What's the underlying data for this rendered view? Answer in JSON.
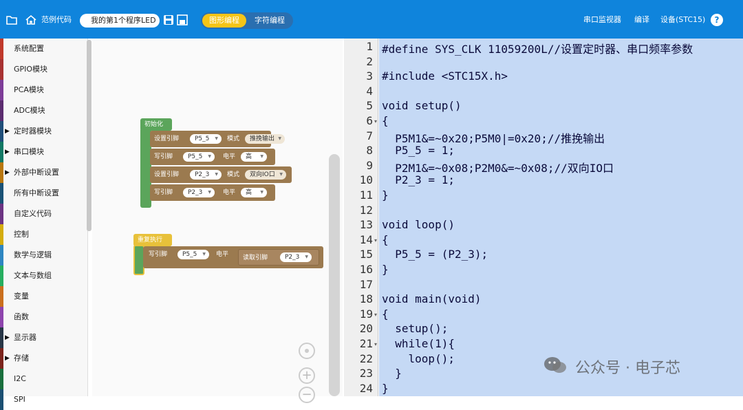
{
  "colors": {
    "topbar": "#0f84dc",
    "tab_active": "#f5c518",
    "selection": "#c5d9f5",
    "init_block": "#5ba55b",
    "loop_block": "#e8c13a",
    "io_block": "#9b7a4f"
  },
  "toolbar": {
    "open_icon": "folder-open-icon",
    "examples_icon": "home-icon",
    "examples_label": "范例代码",
    "project_name": "我的第1个程序LED",
    "tabs": [
      "图形编程",
      "字符编程"
    ],
    "serial_monitor": "串口监视器",
    "compile": "编译",
    "device": "设备(STC15)",
    "help": "?"
  },
  "sidebar": {
    "items": [
      {
        "label": "系统配置",
        "color": "#c0392b",
        "arrow": false
      },
      {
        "label": "GPIO模块",
        "color": "#a83232",
        "arrow": false
      },
      {
        "label": "PCA模块",
        "color": "#7d3c98",
        "arrow": false
      },
      {
        "label": "ADC模块",
        "color": "#5b2c6f",
        "arrow": false
      },
      {
        "label": "定时器模块",
        "color": "#1f4e79",
        "arrow": true
      },
      {
        "label": "串口模块",
        "color": "#117864",
        "arrow": true
      },
      {
        "label": "外部中断设置",
        "color": "#b9770e",
        "arrow": true
      },
      {
        "label": "所有中断设置",
        "color": "#1a5276",
        "arrow": false
      },
      {
        "label": "自定义代码",
        "color": "#6c3483",
        "arrow": false
      },
      {
        "label": "控制",
        "color": "#d4ac0d",
        "arrow": false
      },
      {
        "label": "数学与逻辑",
        "color": "#2e86c1",
        "arrow": false
      },
      {
        "label": "文本与数组",
        "color": "#27ae60",
        "arrow": false
      },
      {
        "label": "变量",
        "color": "#ca6f1e",
        "arrow": false
      },
      {
        "label": "函数",
        "color": "#8e44ad",
        "arrow": false
      },
      {
        "label": "显示器",
        "color": "#283747",
        "arrow": true
      },
      {
        "label": "存储",
        "color": "#7b241c",
        "arrow": true
      },
      {
        "label": "I2C",
        "color": "#196f3d",
        "arrow": false
      },
      {
        "label": "SPI",
        "color": "#1b4f72",
        "arrow": false
      }
    ]
  },
  "blocks": {
    "init_label": "初始化",
    "set_pin": "设置引脚",
    "mode": "模式",
    "write_pin": "写引脚",
    "level": "电平",
    "pin_p55": "P5_5",
    "pin_p23": "P2_3",
    "mode_pushpull": "推挽输出",
    "mode_bidir": "双向IO口",
    "high": "高",
    "loop_label": "重复执行",
    "read_pin": "读取引脚"
  },
  "controls": {
    "center_icon": "target-icon",
    "zoom_in": "+",
    "zoom_out": "−"
  },
  "code": {
    "lines": [
      "#define SYS_CLK 11059200L//设置定时器、串口频率参数",
      "",
      "#include <STC15X.h>",
      "",
      "void setup()",
      "{",
      "  P5M1&=~0x20;P5M0|=0x20;//推挽输出",
      "  P5_5 = 1;",
      "  P2M1&=~0x08;P2M0&=~0x08;//双向IO口",
      "  P2_3 = 1;",
      "}",
      "",
      "void loop()",
      "{",
      "  P5_5 = (P2_3);",
      "}",
      "",
      "void main(void)",
      "{",
      "  setup();",
      "  while(1){",
      "    loop();",
      "  }",
      "}"
    ],
    "line_numbers": [
      "1",
      "2",
      "3",
      "4",
      "5",
      "6",
      "7",
      "8",
      "9",
      "10",
      "11",
      "12",
      "13",
      "14",
      "15",
      "16",
      "17",
      "18",
      "19",
      "20",
      "21",
      "22",
      "23",
      "24"
    ]
  },
  "watermark": {
    "icon": "wechat-icon",
    "text": "公众号 · 电子芯"
  }
}
